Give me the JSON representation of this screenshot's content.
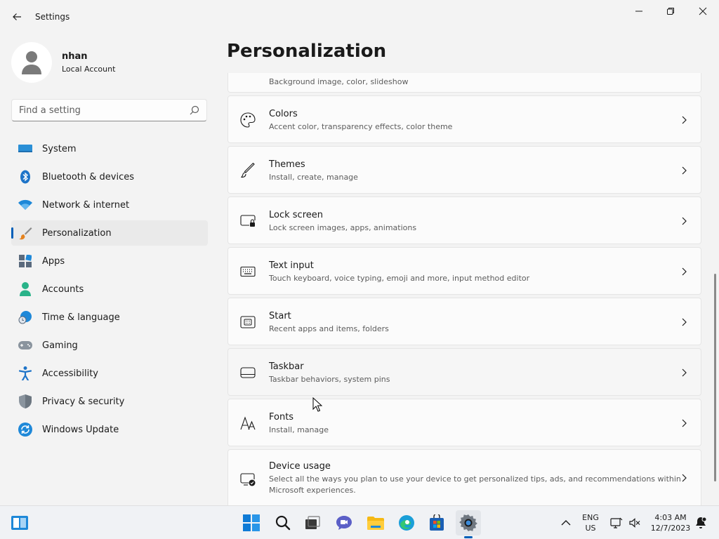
{
  "window": {
    "title": "Settings"
  },
  "profile": {
    "name": "nhan",
    "account_type": "Local Account"
  },
  "search": {
    "placeholder": "Find a setting"
  },
  "sidebar": {
    "items": [
      {
        "label": "System",
        "icon": "system-icon",
        "active": false
      },
      {
        "label": "Bluetooth & devices",
        "icon": "bluetooth-icon",
        "active": false
      },
      {
        "label": "Network & internet",
        "icon": "wifi-icon",
        "active": false
      },
      {
        "label": "Personalization",
        "icon": "brush-icon",
        "active": true
      },
      {
        "label": "Apps",
        "icon": "apps-icon",
        "active": false
      },
      {
        "label": "Accounts",
        "icon": "accounts-icon",
        "active": false
      },
      {
        "label": "Time & language",
        "icon": "time-language-icon",
        "active": false
      },
      {
        "label": "Gaming",
        "icon": "gamepad-icon",
        "active": false
      },
      {
        "label": "Accessibility",
        "icon": "accessibility-icon",
        "active": false
      },
      {
        "label": "Privacy & security",
        "icon": "shield-icon",
        "active": false
      },
      {
        "label": "Windows Update",
        "icon": "update-icon",
        "active": false
      }
    ]
  },
  "main": {
    "title": "Personalization",
    "cards": [
      {
        "title": "",
        "subtitle": "Background image, color, slideshow",
        "icon": "background-icon"
      },
      {
        "title": "Colors",
        "subtitle": "Accent color, transparency effects, color theme",
        "icon": "palette-icon"
      },
      {
        "title": "Themes",
        "subtitle": "Install, create, manage",
        "icon": "brush-pen-icon"
      },
      {
        "title": "Lock screen",
        "subtitle": "Lock screen images, apps, animations",
        "icon": "lock-screen-icon"
      },
      {
        "title": "Text input",
        "subtitle": "Touch keyboard, voice typing, emoji and more, input method editor",
        "icon": "keyboard-icon"
      },
      {
        "title": "Start",
        "subtitle": "Recent apps and items, folders",
        "icon": "start-icon"
      },
      {
        "title": "Taskbar",
        "subtitle": "Taskbar behaviors, system pins",
        "icon": "taskbar-icon"
      },
      {
        "title": "Fonts",
        "subtitle": "Install, manage",
        "icon": "fonts-icon"
      },
      {
        "title": "Device usage",
        "subtitle": "Select all the ways you plan to use your device to get personalized tips, ads, and recommendations within Microsoft experiences.",
        "icon": "device-usage-icon"
      }
    ]
  },
  "taskbar": {
    "apps": [
      "widgets-icon",
      "start-icon",
      "search-icon",
      "task-view-icon",
      "chat-icon",
      "file-explorer-icon",
      "edge-icon",
      "store-icon",
      "settings-icon"
    ],
    "active_app": "settings-icon",
    "language": "ENG",
    "region": "US",
    "time": "4:03 AM",
    "date": "12/7/2023"
  },
  "colors": {
    "accent": "#005fb8"
  }
}
